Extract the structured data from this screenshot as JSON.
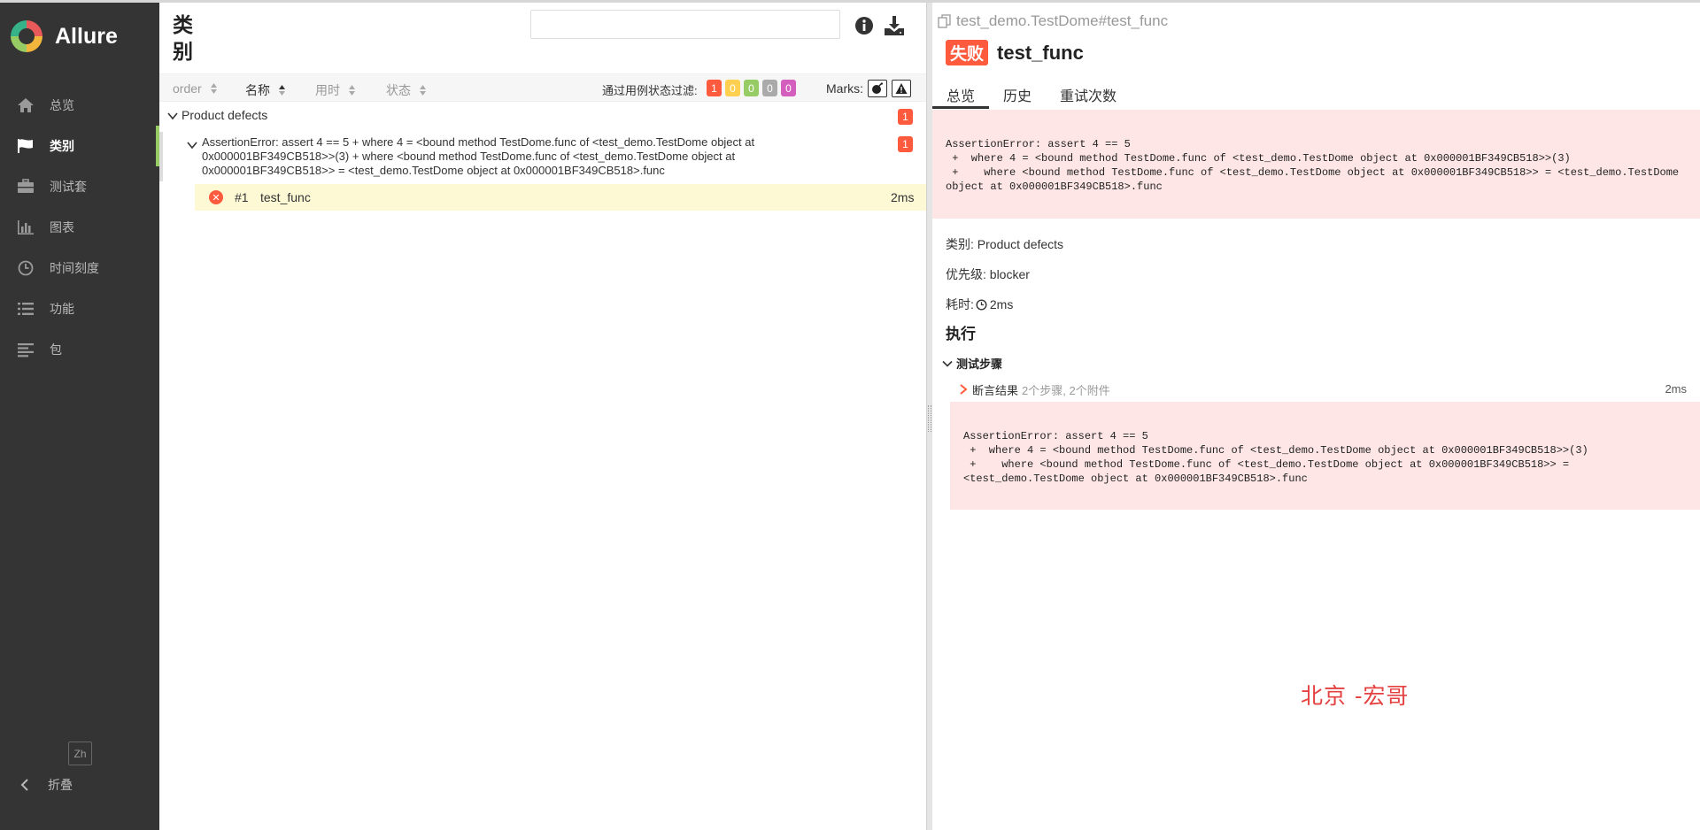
{
  "app": {
    "name": "Allure"
  },
  "sidebar": {
    "items": [
      {
        "label": "总览",
        "icon": "home-icon"
      },
      {
        "label": "类别",
        "icon": "flag-icon",
        "active": true
      },
      {
        "label": "测试套",
        "icon": "briefcase-icon"
      },
      {
        "label": "图表",
        "icon": "bar-chart-icon"
      },
      {
        "label": "时间刻度",
        "icon": "clock-icon"
      },
      {
        "label": "功能",
        "icon": "list-icon"
      },
      {
        "label": "包",
        "icon": "align-left-icon"
      }
    ],
    "lang": "Zh",
    "collapse": "折叠"
  },
  "categories": {
    "title": "类别",
    "search_placeholder": "",
    "sort": {
      "order": "order",
      "name": "名称",
      "duration": "用时",
      "status": "状态"
    },
    "filter_label": "通过用例状态过滤:",
    "status_counts": [
      {
        "status": "failed",
        "count": "1",
        "color": "#fd5a3e"
      },
      {
        "status": "broken",
        "count": "0",
        "color": "#ffd050"
      },
      {
        "status": "passed",
        "count": "0",
        "color": "#97cc64"
      },
      {
        "status": "skipped",
        "count": "0",
        "color": "#aaaaaa"
      },
      {
        "status": "unknown",
        "count": "0",
        "color": "#d35ebe"
      }
    ],
    "marks_label": "Marks:",
    "group": {
      "label": "Product defects",
      "count": "1",
      "sub": {
        "label": "AssertionError: assert 4 == 5 + where 4 = <bound method TestDome.func of <test_demo.TestDome object at 0x000001BF349CB518>>(3) + where <bound method TestDome.func of <test_demo.TestDome object at 0x000001BF349CB518>> = <test_demo.TestDome object at 0x000001BF349CB518>.func",
        "count": "1",
        "test": {
          "num": "#1",
          "name": "test_func",
          "duration": "2ms"
        }
      }
    }
  },
  "detail": {
    "crumb": "test_demo.TestDome#test_func",
    "status": "失败",
    "title": "test_func",
    "tabs": [
      "总览",
      "历史",
      "重试次数"
    ],
    "error": "AssertionError: assert 4 == 5\n +  where 4 = <bound method TestDome.func of <test_demo.TestDome object at 0x000001BF349CB518>>(3)\n +    where <bound method TestDome.func of <test_demo.TestDome object at 0x000001BF349CB518>> = <test_demo.TestDome object at 0x000001BF349CB518>.func",
    "category_key": "类别:",
    "category_val": "Product defects",
    "severity_key": "优先级:",
    "severity_val": "blocker",
    "duration_key": "耗时:",
    "duration_val": "2ms",
    "execution": "执行",
    "steps_header": "测试步骤",
    "step": {
      "name": "断言结果",
      "meta": "2个步骤, 2个附件",
      "duration": "2ms"
    },
    "step_error": "AssertionError: assert 4 == 5\n +  where 4 = <bound method TestDome.func of <test_demo.TestDome object at 0x000001BF349CB518>>(3)\n +    where <bound method TestDome.func of <test_demo.TestDome object at 0x000001BF349CB518>> = <test_demo.TestDome object at 0x000001BF349CB518>.func"
  },
  "watermark": "北京 -宏哥"
}
